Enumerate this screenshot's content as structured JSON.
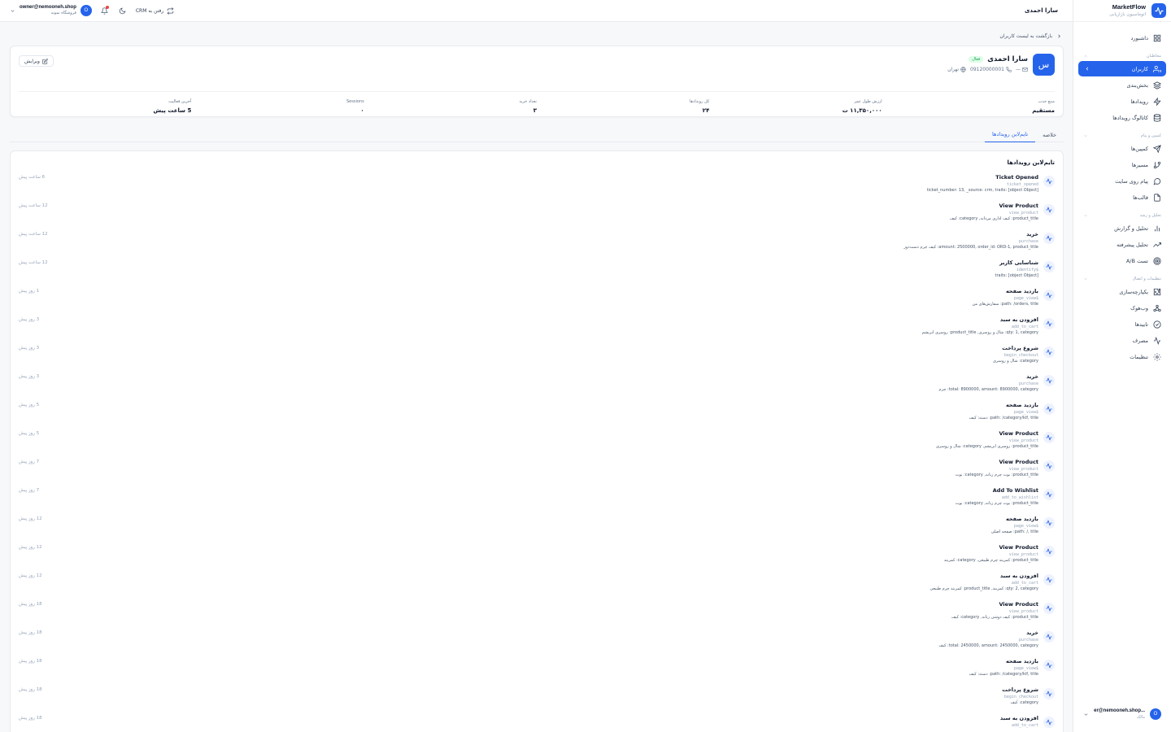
{
  "brand": {
    "name": "MarketFlow",
    "subtitle": "اتوماسیون بازاریابی"
  },
  "nav": {
    "dashboard": "داشبورد",
    "section_audience": "مخاطبان",
    "users": "کاربران",
    "segments": "بخش‌بندی",
    "events": "رویدادها",
    "event_catalog": "کاتالوگ رویدادها",
    "section_campaigns": "کمپین و پیام",
    "campaigns": "کمپین‌ها",
    "journeys": "مسیرها",
    "onsite": "پیام روی سایت",
    "templates": "قالب‌ها",
    "section_analytics": "تحلیل و رشد",
    "reports": "تحلیل و گزارش",
    "advanced": "تحلیل پیشرفته",
    "ab_test": "تست A/B",
    "section_settings": "تنظیمات و اتصال",
    "integrations": "یکپارچه‌سازی",
    "webhooks": "وب‌هوک",
    "approvals": "تاییدها",
    "usage": "مصرف",
    "settings": "تنظیمات"
  },
  "sidebar_user": {
    "email": "...er@nemooneh.shop",
    "role": "مالک",
    "initial": "O"
  },
  "topbar": {
    "title": "سارا احمدی",
    "crm": "رفتن به CRM",
    "email": "owner@nemooneh.shop",
    "store": "فروشگاه نمونه",
    "initial": "O"
  },
  "back": "بازگشت به لیست کاربران",
  "profile": {
    "initial": "س",
    "name": "سارا احمدی",
    "status": "فعال",
    "email": "—",
    "phone": "09120000001",
    "city": "تهران",
    "edit": "ویرایش"
  },
  "stats": [
    {
      "label": "منبع جذب",
      "value": "مستقیم"
    },
    {
      "label": "ارزش طول عمر",
      "value": "۱۱,۳۵۰,۰۰۰ ت"
    },
    {
      "label": "کل رویدادها",
      "value": "۲۴"
    },
    {
      "label": "تعداد خرید",
      "value": "۳"
    },
    {
      "label": "Sessions",
      "value": "۰"
    },
    {
      "label": "آخرین فعالیت",
      "value": "5 ساعت پیش"
    }
  ],
  "tabs": {
    "summary": "خلاصه",
    "timeline": "تایم‌لاین رویدادها"
  },
  "timeline": {
    "title": "تایم‌لاین رویدادها",
    "events": [
      {
        "name": "Ticket Opened",
        "code": "ticket_opened",
        "props": "ticket_number: 13, _source: crm, traits: [object Object]",
        "time": "6 ساعت پیش"
      },
      {
        "name": "View Product",
        "code": "view_product",
        "props": "product_title: کیف اداری مردانه, category: کیف",
        "time": "12 ساعت پیش"
      },
      {
        "name": "خرید",
        "code": "purchase",
        "props": "amount: 2500000, order_id: ORD-1, product_title: کیف چرم دست‌دوز",
        "time": "12 ساعت پیش"
      },
      {
        "name": "شناسایی کاربر",
        "code": "$identify",
        "props": "traits: [object Object]",
        "time": "12 ساعت پیش"
      },
      {
        "name": "بازدید صفحه",
        "code": "$page_view",
        "props": "path: /orders, title: سفارش‌های من",
        "time": "1 روز پیش"
      },
      {
        "name": "افزودن به سبد",
        "code": "add_to_cart",
        "props": "qty: 1, category: شال و روسری, product_title: روسری ابریشم",
        "time": "3 روز پیش"
      },
      {
        "name": "شروع پرداخت",
        "code": "begin_checkout",
        "props": "category: شال و روسری",
        "time": "3 روز پیش"
      },
      {
        "name": "خرید",
        "code": "purchase",
        "props": "total: 8900000, amount: 8900000, category: چرم",
        "time": "3 روز پیش"
      },
      {
        "name": "بازدید صفحه",
        "code": "$page_view",
        "props": "path: /category/kif, title: دسته: کیف",
        "time": "5 روز پیش"
      },
      {
        "name": "View Product",
        "code": "view_product",
        "props": "product_title: روسری ابریشم, category: شال و روسری",
        "time": "5 روز پیش"
      },
      {
        "name": "View Product",
        "code": "view_product",
        "props": "product_title: بوت چرم زنانه, category: بوت",
        "time": "7 روز پیش"
      },
      {
        "name": "Add To Wishlist",
        "code": "add_to_wishlist",
        "props": "product_title: بوت چرم زنانه, category: بوت",
        "time": "7 روز پیش"
      },
      {
        "name": "بازدید صفحه",
        "code": "$page_view",
        "props": "path: /, title: صفحه اصلی",
        "time": "12 روز پیش"
      },
      {
        "name": "View Product",
        "code": "view_product",
        "props": "product_title: کمربند چرم طبیعی, category: کمربند",
        "time": "12 روز پیش"
      },
      {
        "name": "افزودن به سبد",
        "code": "add_to_cart",
        "props": "qty: 2, category: کمربند, product_title: کمربند چرم طبیعی",
        "time": "12 روز پیش"
      },
      {
        "name": "View Product",
        "code": "view_product",
        "props": "product_title: کیف دوشی زنانه, category: کیف",
        "time": "18 روز پیش"
      },
      {
        "name": "خرید",
        "code": "purchase",
        "props": "total: 2450000, amount: 2450000, category: کیف",
        "time": "18 روز پیش"
      },
      {
        "name": "بازدید صفحه",
        "code": "$page_view",
        "props": "path: /category/kif, title: دسته: کیف",
        "time": "18 روز پیش"
      },
      {
        "name": "شروع پرداخت",
        "code": "begin_checkout",
        "props": "category: کیف",
        "time": "18 روز پیش"
      },
      {
        "name": "افزودن به سبد",
        "code": "add_to_cart",
        "props": "",
        "time": "18 روز پیش"
      }
    ]
  }
}
